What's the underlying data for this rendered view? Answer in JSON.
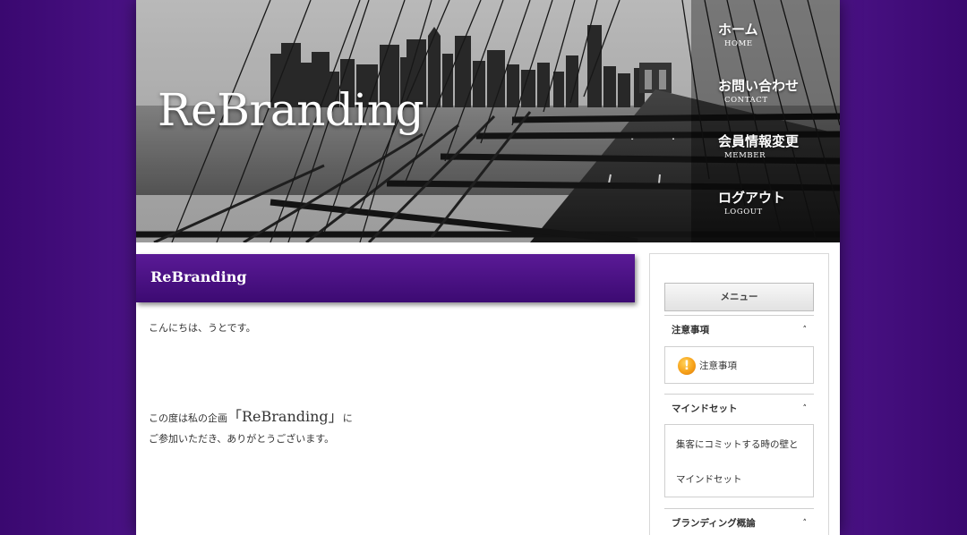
{
  "site": {
    "title": "ReBranding"
  },
  "nav": {
    "items": [
      {
        "jp": "ホーム",
        "en": "HOME"
      },
      {
        "jp": "お問い合わせ",
        "en": "CONTACT"
      },
      {
        "jp": "会員情報変更",
        "en": "MEMBER"
      },
      {
        "jp": "ログアウト",
        "en": "LOGOUT"
      }
    ]
  },
  "main": {
    "heading": "ReBranding",
    "paragraphs": {
      "greeting": "こんにちは、うとです。",
      "line1_prefix": "この度は私の企画",
      "line1_project": "「ReBranding」",
      "line1_suffix": "に",
      "line2": "ご参加いただき、ありがとうございます。"
    }
  },
  "sidebar": {
    "menu_label": "メニュー",
    "sections": [
      {
        "title": "注意事項",
        "links": [
          "注意事項"
        ]
      },
      {
        "title": "マインドセット",
        "links": [
          "集客にコミットする時の壁と",
          "マインドセット"
        ]
      },
      {
        "title": "ブランディング概論",
        "links": []
      }
    ]
  },
  "colors": {
    "background_purple": "#4a1285",
    "title_bar_purple": "#4a107e",
    "warning_orange": "#f7a21a"
  },
  "icons": {
    "warning": "exclamation-circle-icon",
    "chevron": "chevron-up-icon"
  }
}
